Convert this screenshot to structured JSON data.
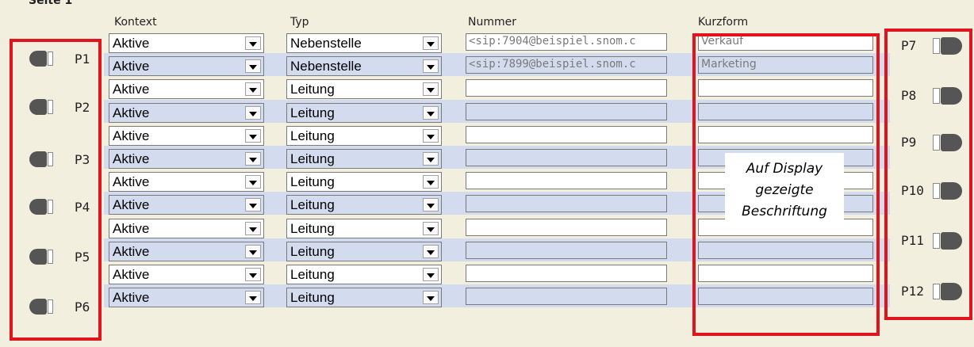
{
  "page": {
    "section_title": "Seite 1"
  },
  "headers": {
    "kontext": "Kontext",
    "typ": "Typ",
    "nummer": "Nummer",
    "kurzform": "Kurzform"
  },
  "rows": [
    {
      "kontext": "Aktive",
      "typ": "Nebenstelle",
      "nummer": "<sip:7904@beispiel.snom.c",
      "kurzform": "Verkauf"
    },
    {
      "kontext": "Aktive",
      "typ": "Nebenstelle",
      "nummer": "<sip:7899@beispiel.snom.c",
      "kurzform": "Marketing"
    },
    {
      "kontext": "Aktive",
      "typ": "Leitung",
      "nummer": "",
      "kurzform": ""
    },
    {
      "kontext": "Aktive",
      "typ": "Leitung",
      "nummer": "",
      "kurzform": ""
    },
    {
      "kontext": "Aktive",
      "typ": "Leitung",
      "nummer": "",
      "kurzform": ""
    },
    {
      "kontext": "Aktive",
      "typ": "Leitung",
      "nummer": "",
      "kurzform": ""
    },
    {
      "kontext": "Aktive",
      "typ": "Leitung",
      "nummer": "",
      "kurzform": ""
    },
    {
      "kontext": "Aktive",
      "typ": "Leitung",
      "nummer": "",
      "kurzform": ""
    },
    {
      "kontext": "Aktive",
      "typ": "Leitung",
      "nummer": "",
      "kurzform": ""
    },
    {
      "kontext": "Aktive",
      "typ": "Leitung",
      "nummer": "",
      "kurzform": ""
    },
    {
      "kontext": "Aktive",
      "typ": "Leitung",
      "nummer": "",
      "kurzform": ""
    },
    {
      "kontext": "Aktive",
      "typ": "Leitung",
      "nummer": "",
      "kurzform": ""
    }
  ],
  "left_keys": [
    "P1",
    "P2",
    "P3",
    "P4",
    "P5",
    "P6"
  ],
  "right_keys": [
    "P7",
    "P8",
    "P9",
    "P10",
    "P11",
    "P12"
  ],
  "callout": {
    "line1": "Auf Display",
    "line2": "gezeigte",
    "line3": "Beschriftung"
  },
  "annotation_color": "#e0141c",
  "row_shade_color": "#d3dcef",
  "icons": {
    "left_keys": "key-led-icon",
    "right_keys": "key-led-icon",
    "dropdown": "dropdown-arrow-icon"
  }
}
